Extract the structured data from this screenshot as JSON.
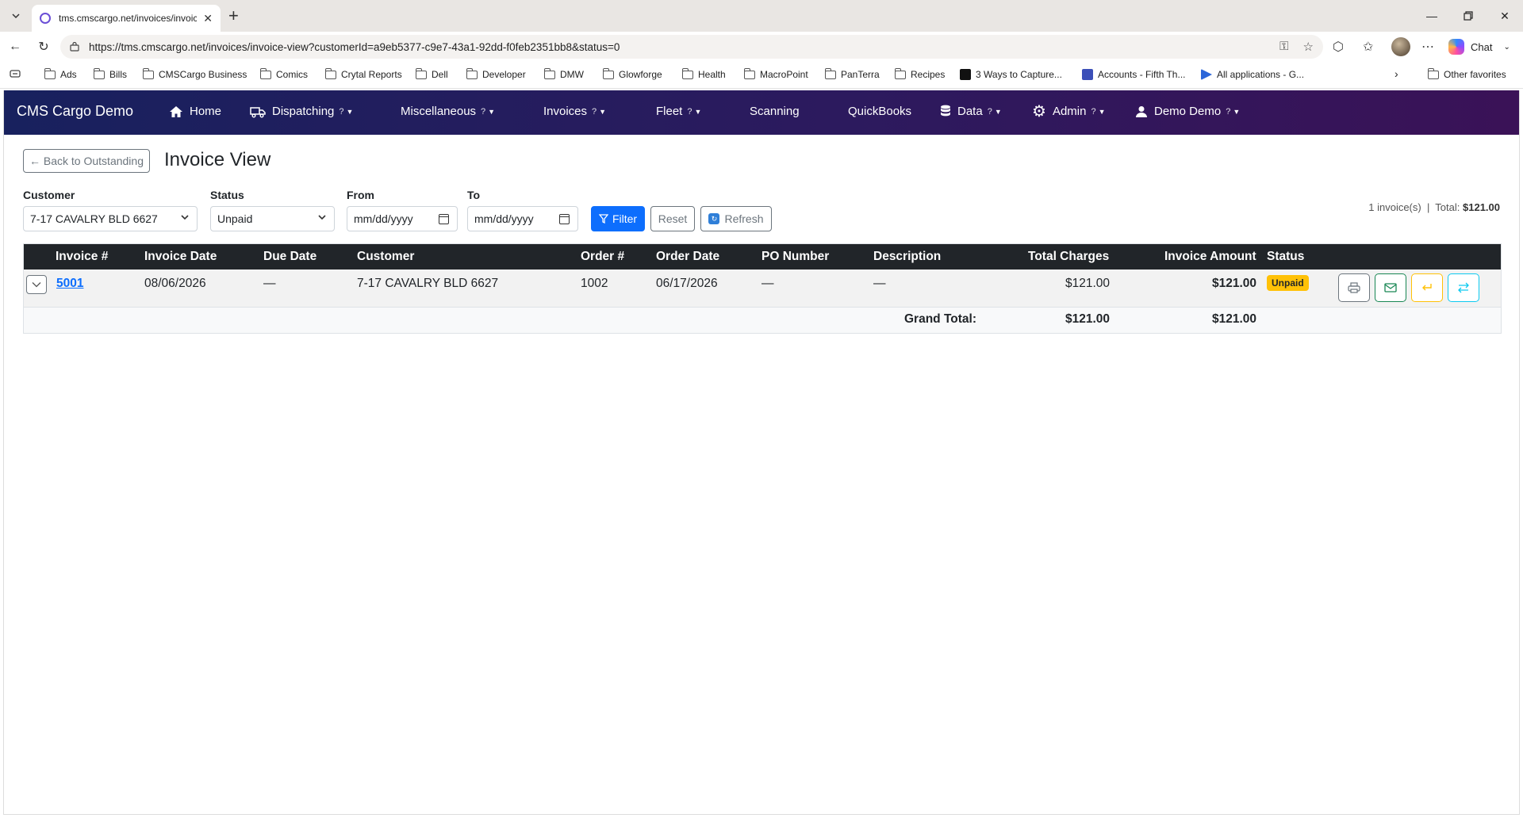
{
  "browser": {
    "tab_title": "tms.cmscargo.net/invoices/invoice",
    "url": "https://tms.cmscargo.net/invoices/invoice-view?customerId=a9eb5377-c9e7-43a1-92dd-f0feb2351bb8&status=0",
    "chat_label": "Chat",
    "bookmarks": [
      "Ads",
      "Bills",
      "CMSCargo Business",
      "Comics",
      "Crytal Reports",
      "Dell",
      "Developer",
      "DMW",
      "Glowforge",
      "Health",
      "MacroPoint",
      "PanTerra",
      "Recipes",
      "3 Ways to Capture...",
      "Accounts - Fifth Th...",
      "All applications - G..."
    ],
    "other_favorites": "Other favorites"
  },
  "nav": {
    "brand": "CMS Cargo Demo",
    "home": "Home",
    "dispatching": "Dispatching",
    "miscellaneous": "Miscellaneous",
    "invoices": "Invoices",
    "fleet": "Fleet",
    "scanning": "Scanning",
    "quickbooks": "QuickBooks",
    "data": "Data",
    "admin": "Admin",
    "user": "Demo Demo",
    "help_mark": "?"
  },
  "page": {
    "back_label": "← Back to Outstanding",
    "title": "Invoice View"
  },
  "filters": {
    "customer_label": "Customer",
    "customer_value": "7-17 CAVALRY BLD 6627",
    "status_label": "Status",
    "status_value": "Unpaid",
    "from_label": "From",
    "from_placeholder": "mm/dd/yyyy",
    "to_label": "To",
    "to_placeholder": "mm/dd/yyyy",
    "filter_label": "Filter",
    "reset_label": "Reset",
    "refresh_label": "Refresh"
  },
  "summary": {
    "count_text": "1 invoice(s)  |  Total: ",
    "total": "$121.00"
  },
  "table": {
    "headers": [
      "Invoice #",
      "Invoice Date",
      "Due Date",
      "Customer",
      "Order #",
      "Order Date",
      "PO Number",
      "Description",
      "Total Charges",
      "Invoice Amount",
      "Status"
    ],
    "rows": [
      {
        "invoice_no": "5001",
        "invoice_date": "08/06/2026",
        "due_date": "—",
        "customer": "7-17 CAVALRY BLD 6627",
        "order_no": "1002",
        "order_date": "06/17/2026",
        "po_number": "—",
        "description": "—",
        "total_charges": "$121.00",
        "invoice_amount": "$121.00",
        "status": "Unpaid"
      }
    ],
    "footer": {
      "label": "Grand Total:",
      "total_charges": "$121.00",
      "invoice_amount": "$121.00"
    }
  },
  "colors": {
    "primary": "#0d6efd",
    "badge_unpaid": "#ffc107",
    "nav_start": "#18215e",
    "nav_end": "#3a1257",
    "table_header": "#212529"
  }
}
